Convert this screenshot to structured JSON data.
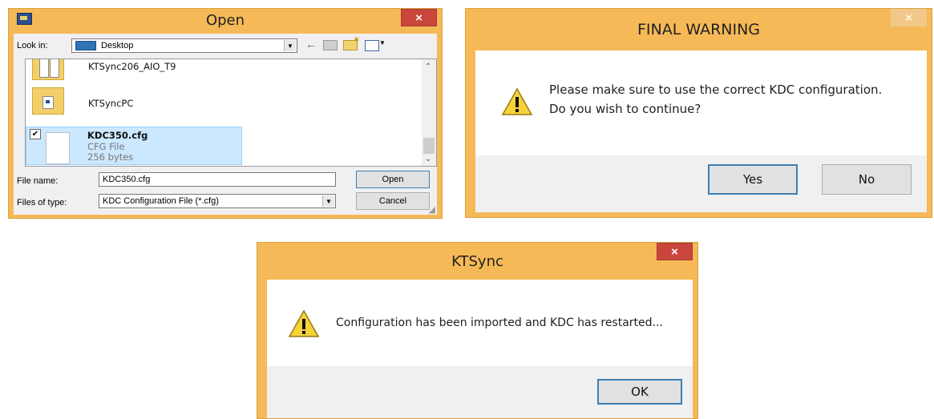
{
  "open_dialog": {
    "title": "Open",
    "close_label": "×",
    "look_in_label": "Look in:",
    "look_in_value": "Desktop",
    "files": [
      {
        "name": "KTSync206_AIO_T9"
      },
      {
        "name": "KTSyncPC"
      },
      {
        "name": "KDC350.cfg",
        "type": "CFG File",
        "size": "256 bytes",
        "selected": true
      }
    ],
    "file_name_label": "File name:",
    "file_name_value": "KDC350.cfg",
    "files_of_type_label": "Files of type:",
    "files_of_type_value": "KDC Configuration File (*.cfg)",
    "open_button": "Open",
    "cancel_button": "Cancel"
  },
  "final_warning": {
    "title": "FINAL WARNING",
    "close_label": "×",
    "message_line1": "Please make sure to use the correct KDC configuration.",
    "message_line2": "Do you wish to continue?",
    "yes_button": "Yes",
    "no_button": "No"
  },
  "ktsync_dialog": {
    "title": "KTSync",
    "close_label": "×",
    "message": "Configuration has been imported and KDC has restarted...",
    "ok_button": "OK"
  },
  "colors": {
    "frame": "#f6b957",
    "close": "#c9463d",
    "selection": "#cce8ff"
  }
}
